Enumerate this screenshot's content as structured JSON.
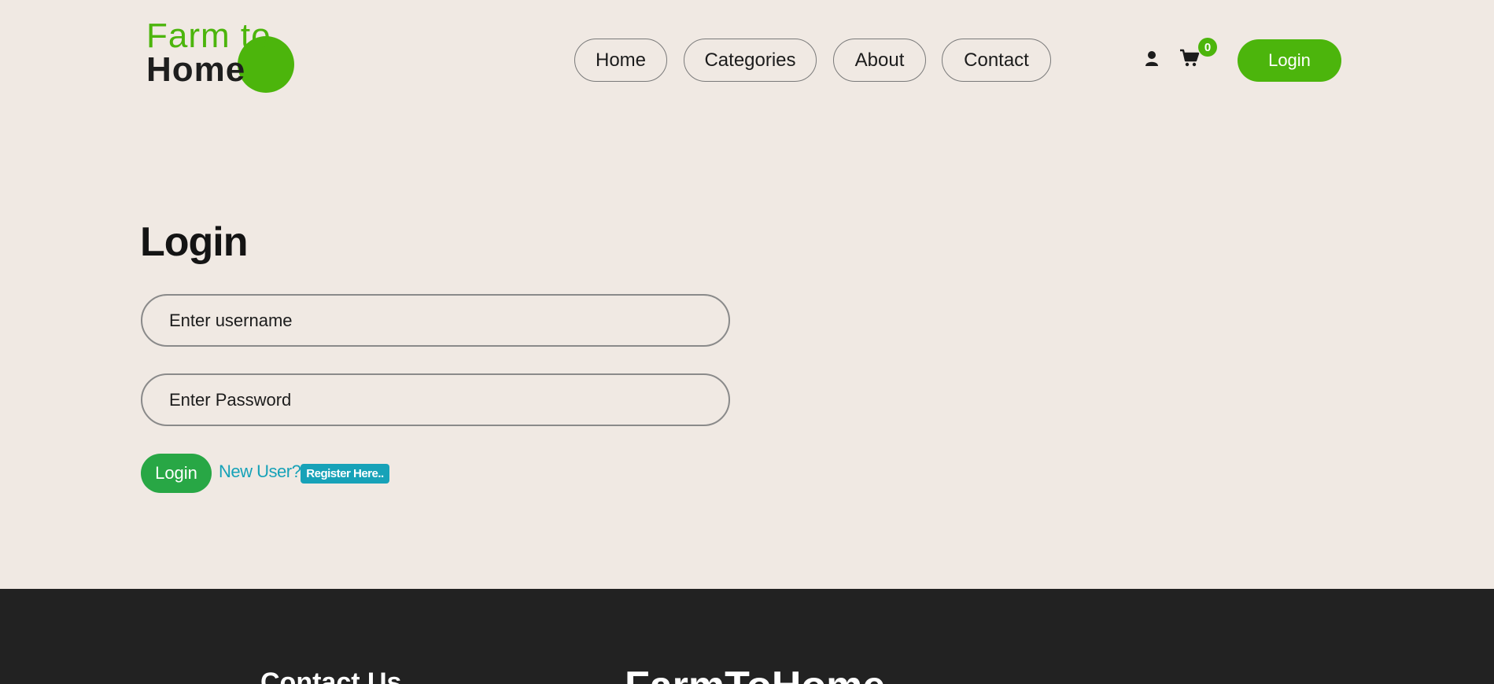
{
  "brand": {
    "line1": "Farm to",
    "line2": "Home",
    "accent_color": "#4cb50c"
  },
  "nav": {
    "items": [
      {
        "label": "Home"
      },
      {
        "label": "Categories"
      },
      {
        "label": "About"
      },
      {
        "label": "Contact"
      }
    ]
  },
  "header_actions": {
    "user_icon": "user-icon",
    "cart_icon": "cart-icon",
    "cart_count": "0",
    "login_label": "Login"
  },
  "login_form": {
    "title": "Login",
    "username_placeholder": "Enter username",
    "password_placeholder": "Enter Password",
    "submit_label": "Login",
    "new_user_text": "New User?",
    "register_label": "Register Here..",
    "submit_color": "#28a745",
    "link_color": "#17a2b8"
  },
  "footer": {
    "contact_heading": "Contact Us",
    "brand_heading": "FarmToHome",
    "background_color": "#222222"
  }
}
